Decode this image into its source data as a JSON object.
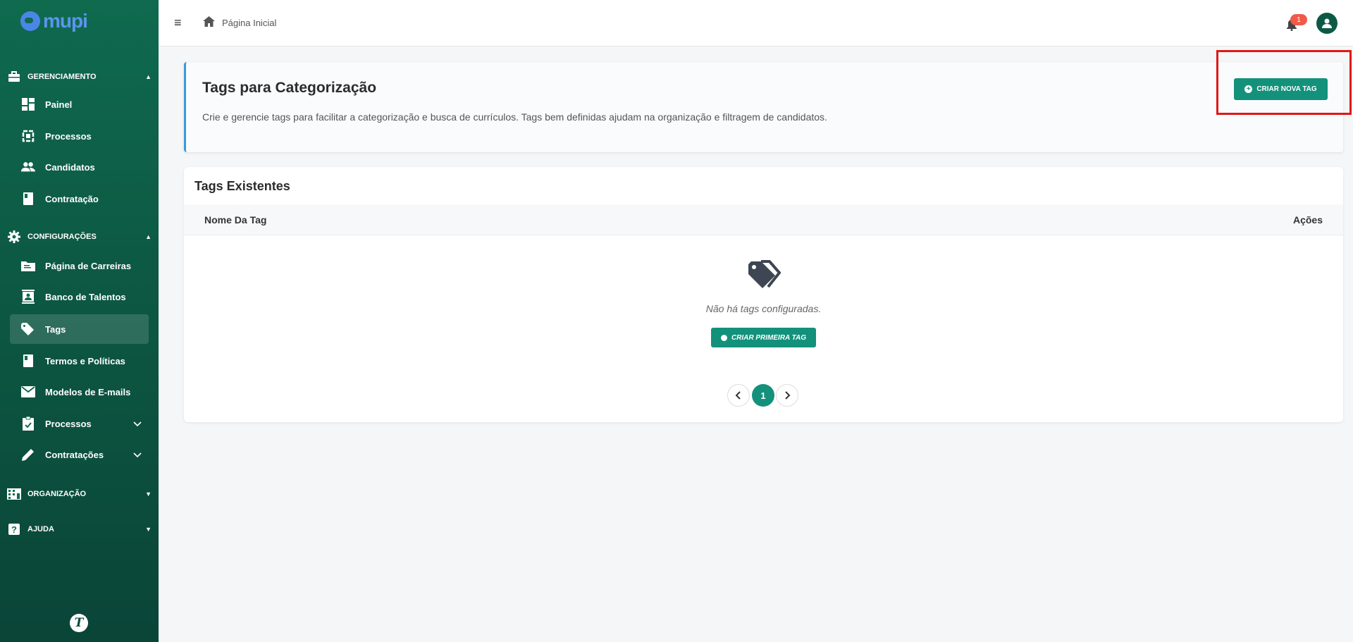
{
  "sidebar": {
    "logo_text": "mupi",
    "sections": {
      "gerenciamento": "GERENCIAMENTO",
      "configuracoes": "CONFIGURAÇÕES",
      "organizacao": "ORGANIZAÇÃO",
      "ajuda": "AJUDA"
    },
    "items": {
      "painel": "Painel",
      "processos": "Processos",
      "candidatos": "Candidatos",
      "contratacao": "Contratação",
      "pagina_carreiras": "Página de Carreiras",
      "banco_talentos": "Banco de Talentos",
      "tags": "Tags",
      "termos": "Termos e Políticas",
      "modelos_emails": "Modelos de E-mails",
      "processos_config": "Processos",
      "contratacoes": "Contratações"
    },
    "footer_icon_letter": "T"
  },
  "topbar": {
    "breadcrumb": "Página Inicial",
    "notification_count": "1"
  },
  "intro": {
    "title": "Tags para Categorização",
    "description": "Crie e gerencie tags para facilitar a categorização e busca de currículos. Tags bem definidas ajudam na organização e filtragem de candidatos.",
    "create_button": "CRIAR NOVA TAG"
  },
  "tags_table": {
    "title": "Tags Existentes",
    "columns": [
      "Nome Da Tag",
      "Ações"
    ],
    "empty_text": "Não há tags configuradas.",
    "create_first_button": "CRIAR PRIMEIRA TAG",
    "current_page": "1"
  },
  "colors": {
    "sidebar": "#0f6a4e",
    "accent": "#13917b",
    "highlight": "#e01818",
    "badge": "#f05a4b"
  }
}
